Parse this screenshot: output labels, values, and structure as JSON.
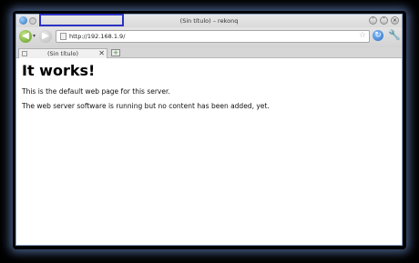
{
  "window": {
    "title": "(Sin título) – rekonq",
    "minimize_glyph": "˅",
    "maximize_glyph": "˄",
    "close_glyph": "✕"
  },
  "toolbar": {
    "back_glyph": "◀",
    "back_menu_glyph": "▾",
    "forward_glyph": "▶",
    "url": "http://192.168.1.9/",
    "bookmark_glyph": "☆",
    "reload_glyph": "↻",
    "tools_glyph": "🔧",
    "highlight_color": "#2c33c4"
  },
  "tabs": [
    {
      "label": "(Sin título)",
      "close_glyph": "✕"
    }
  ],
  "new_tab_glyph": "+",
  "page": {
    "heading": "It works!",
    "paragraph1": "This is the default web page for this server.",
    "paragraph2": "The web server software is running but no content has been added, yet."
  }
}
